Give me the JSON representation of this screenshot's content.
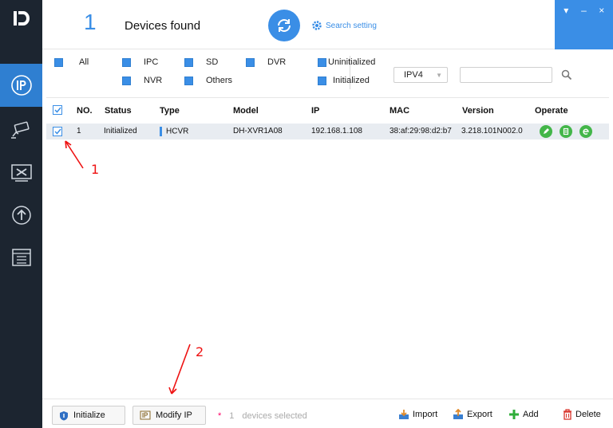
{
  "app": {
    "logo": "Ḋ"
  },
  "header": {
    "count": "1",
    "devices_found": "Devices found",
    "search_setting": "Search setting",
    "window_controls": {
      "menu": "▾",
      "minimize": "–",
      "close": "×"
    }
  },
  "filters": {
    "all": "All",
    "ipc": "IPC",
    "sd": "SD",
    "dvr": "DVR",
    "nvr": "NVR",
    "others": "Others",
    "uninitialized": "Uninitialized",
    "initialized": "Initialized",
    "ip_version": "IPV4",
    "search_placeholder": ""
  },
  "table": {
    "headers": [
      "NO.",
      "Status",
      "Type",
      "Model",
      "IP",
      "MAC",
      "Version",
      "Operate"
    ],
    "rows": [
      {
        "no": "1",
        "status": "Initialized",
        "type": "HCVR",
        "model": "DH-XVR1A08",
        "ip": "192.168.1.108",
        "mac": "38:af:29:98:d2:b7",
        "version": "3.218.101N002.0"
      }
    ]
  },
  "annotations": {
    "one": "1",
    "two": "2"
  },
  "bottom": {
    "initialize": "Initialize",
    "modify_ip": "Modify IP",
    "star": "*",
    "selected_count": "1",
    "selected_text": "devices selected",
    "import": "Import",
    "export": "Export",
    "add": "Add",
    "delete": "Delete"
  },
  "colors": {
    "accent": "#3a8ee6",
    "sidebar": "#1c2530",
    "green": "#43b649",
    "annotation": "#e11111"
  }
}
